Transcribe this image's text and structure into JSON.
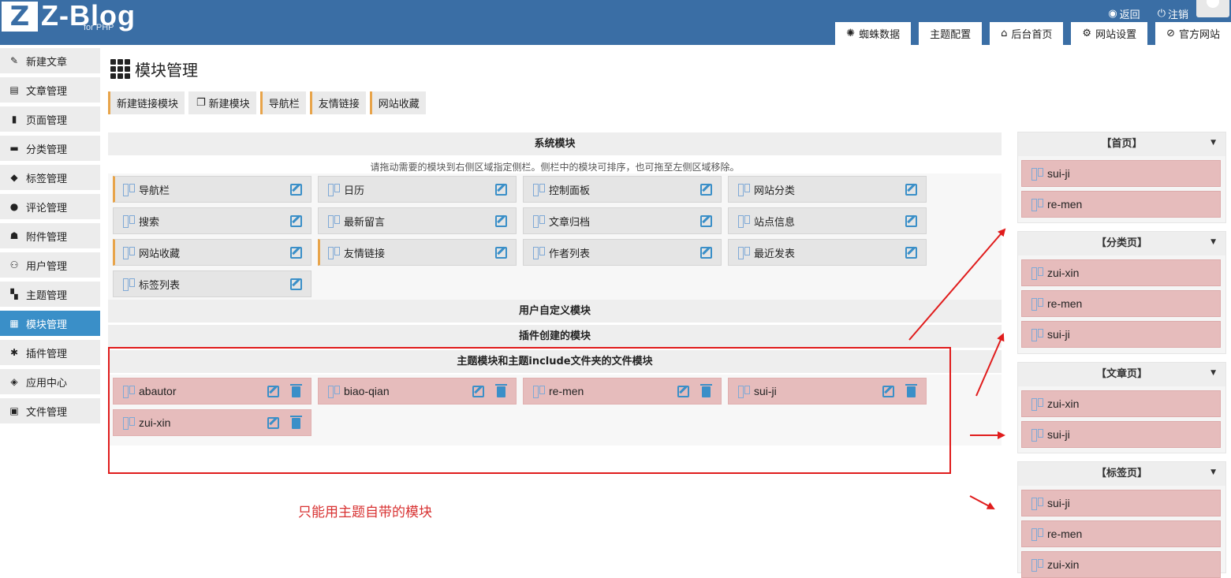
{
  "header": {
    "logo_letter": "Z",
    "logo_text": "Z-Blog",
    "logo_sub": "for PHP",
    "top_links": [
      {
        "label": "返回",
        "icon": "globe-icon"
      },
      {
        "label": "注销",
        "icon": "power-icon"
      }
    ],
    "tabs": [
      {
        "label": "蜘蛛数据",
        "icon": "bug-icon"
      },
      {
        "label": "主题配置",
        "icon": ""
      },
      {
        "label": "后台首页",
        "icon": "home-icon"
      },
      {
        "label": "网站设置",
        "icon": "gear-icon"
      },
      {
        "label": "官方网站",
        "icon": "zblog-icon"
      }
    ]
  },
  "sidebar": {
    "items": [
      {
        "label": "新建文章",
        "icon": "edit-icon"
      },
      {
        "label": "文章管理",
        "icon": "doc-icon"
      },
      {
        "label": "页面管理",
        "icon": "page-icon"
      },
      {
        "label": "分类管理",
        "icon": "folder-icon"
      },
      {
        "label": "标签管理",
        "icon": "tag-icon"
      },
      {
        "label": "评论管理",
        "icon": "comment-icon"
      },
      {
        "label": "附件管理",
        "icon": "attach-icon"
      },
      {
        "label": "用户管理",
        "icon": "users-icon"
      },
      {
        "label": "主题管理",
        "icon": "theme-icon"
      },
      {
        "label": "模块管理",
        "icon": "grid-icon",
        "active": true
      },
      {
        "label": "插件管理",
        "icon": "puzzle-icon"
      },
      {
        "label": "应用中心",
        "icon": "cube-icon"
      },
      {
        "label": "文件管理",
        "icon": "file-icon"
      }
    ]
  },
  "main": {
    "title": "模块管理",
    "buttons": [
      "新建链接模块",
      "新建模块",
      "导航栏",
      "友情链接",
      "网站收藏"
    ],
    "system_title": "系统模块",
    "hint": "请拖动需要的模块到右侧区域指定侧栏。侧栏中的模块可排序，也可拖至左侧区域移除。",
    "system_modules": [
      "导航栏",
      "日历",
      "控制面板",
      "网站分类",
      "搜索",
      "最新留言",
      "文章归档",
      "站点信息",
      "网站收藏",
      "友情链接",
      "作者列表",
      "最近发表",
      "标签列表"
    ],
    "user_title": "用户自定义模块",
    "plugin_title": "插件创建的模块",
    "theme_title": "主题模块和主题include文件夹的文件模块",
    "theme_modules": [
      "abautor",
      "biao-qian",
      "re-men",
      "sui-ji",
      "zui-xin"
    ]
  },
  "sidebars": [
    {
      "title": "【首页】",
      "items": [
        "sui-ji",
        "re-men"
      ]
    },
    {
      "title": "【分类页】",
      "items": [
        "zui-xin",
        "re-men",
        "sui-ji"
      ]
    },
    {
      "title": "【文章页】",
      "items": [
        "zui-xin",
        "sui-ji"
      ]
    },
    {
      "title": "【标签页】",
      "items": [
        "sui-ji",
        "re-men",
        "zui-xin"
      ]
    }
  ],
  "annotation": {
    "note": "只能用主题自带的模块",
    "color": "#e01c1c"
  },
  "colors": {
    "header": "#3a6ea5",
    "active": "#3a8fc8",
    "module_pink": "#e6bcbc",
    "accent_orange": "#e8a44a"
  }
}
